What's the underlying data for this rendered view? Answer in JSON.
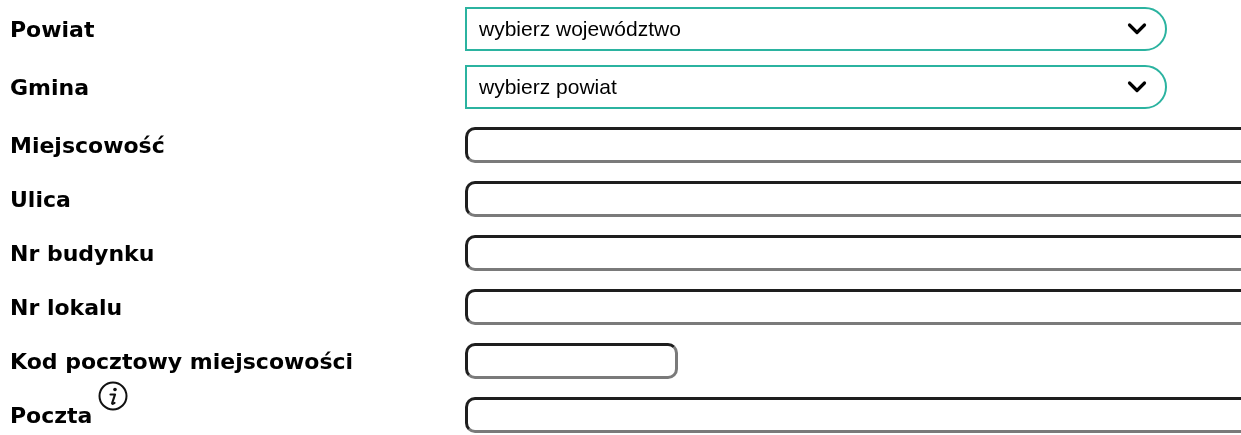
{
  "fields": [
    {
      "label": "Powiat",
      "kind": "select",
      "value": "wybierz województwo"
    },
    {
      "label": "Gmina",
      "kind": "select",
      "value": "wybierz powiat"
    },
    {
      "label": "Miejscowość",
      "kind": "text"
    },
    {
      "label": "Ulica",
      "kind": "text"
    },
    {
      "label": "Nr budynku",
      "kind": "text"
    },
    {
      "label": "Nr lokalu",
      "kind": "text"
    },
    {
      "label": "Kod pocztowy miejscowości",
      "kind": "short"
    },
    {
      "label": "Poczta",
      "kind": "text",
      "info": true
    }
  ]
}
